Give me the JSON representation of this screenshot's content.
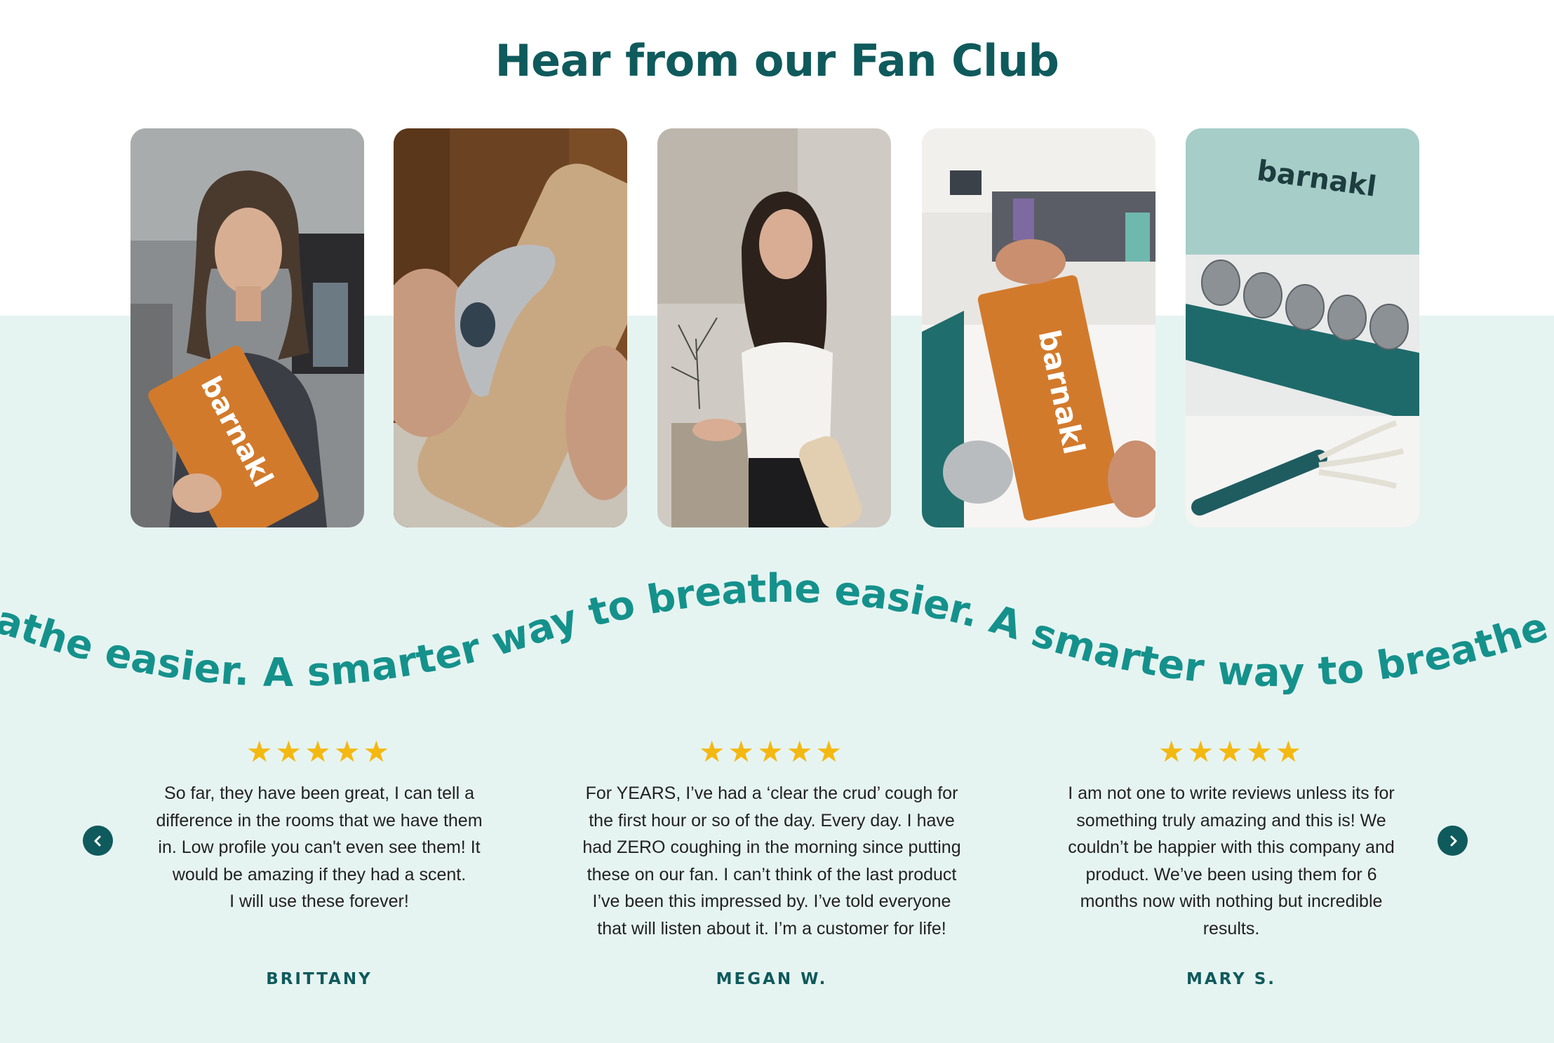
{
  "section": {
    "title": "Hear from our Fan Club"
  },
  "videos": [
    {
      "product_label": "barnakl"
    },
    {
      "product_label": ""
    },
    {
      "product_label": ""
    },
    {
      "product_label": "barnakl"
    },
    {
      "product_label": "barnakl"
    }
  ],
  "tagline": {
    "text": "A smarter way to breathe easier."
  },
  "reviews": [
    {
      "rating": 5,
      "stars": "★★★★★",
      "text": "So far, they have been great, I can tell a\ndifference in the rooms that we have them\nin. Low profile you can't even see them! It\nwould be amazing if they had a scent.\nI will use these forever!",
      "author": "BRITTANY"
    },
    {
      "rating": 5,
      "stars": "★★★★★",
      "text": "For YEARS, I’ve had a ‘clear the crud’ cough for\nthe first hour or so of the day. Every day. I have\nhad ZERO coughing in the morning since putting\nthese on our fan. I can’t think of the last product\nI’ve been this impressed by. I’ve told everyone\nthat will listen about it. I’m a customer for life!",
      "author": "MEGAN W."
    },
    {
      "rating": 5,
      "stars": "★★★★★",
      "text": "I am not one to write reviews unless its for\nsomething truly amazing and this is! We\ncouldn’t be happier with this company and\nproduct. We’ve been using them for 6\nmonths now with nothing but incredible\nresults.",
      "author": "MARY S."
    }
  ],
  "nav": {
    "prev_icon": "chevron-left-icon",
    "next_icon": "chevron-right-icon"
  },
  "colors": {
    "heading": "#0f5a5c",
    "tagline": "#15918c",
    "band": "#e6f4f1",
    "star": "#f4b812",
    "brand_orange": "#d27a2c"
  }
}
